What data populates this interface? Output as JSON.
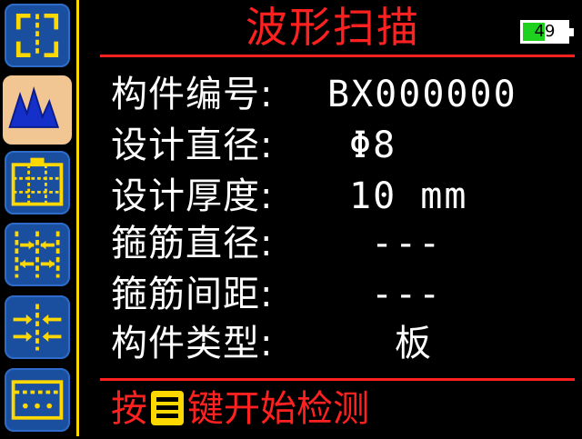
{
  "header": {
    "title": "波形扫描",
    "battery": {
      "level": 49,
      "percent_text": "49",
      "fill_color": "#1fd11f"
    }
  },
  "colors": {
    "accent_red": "#ff2020",
    "accent_yellow": "#ffd800",
    "icon_blue": "#1a4fa0",
    "active_tile": "#f1c692"
  },
  "sidebar": {
    "items": [
      {
        "icon": "frame-scan-icon",
        "active": false
      },
      {
        "icon": "waveform-peaks-icon",
        "active": true
      },
      {
        "icon": "grid-scan-icon",
        "active": false
      },
      {
        "icon": "spacing-arrows-icon",
        "active": false
      },
      {
        "icon": "converge-arrows-icon",
        "active": false
      },
      {
        "icon": "cover-layer-icon",
        "active": false
      }
    ]
  },
  "params": [
    {
      "label": "构件编号:",
      "value": "BX000000"
    },
    {
      "label": "设计直径:",
      "value": "Φ8"
    },
    {
      "label": "设计厚度:",
      "value": "10 mm"
    },
    {
      "label": "箍筋直径:",
      "value": "---"
    },
    {
      "label": "箍筋间距:",
      "value": "---"
    },
    {
      "label": "构件类型:",
      "value": "板"
    }
  ],
  "footer": {
    "prefix": "按",
    "suffix": "键开始检测",
    "key_icon": "menu-key-icon"
  }
}
